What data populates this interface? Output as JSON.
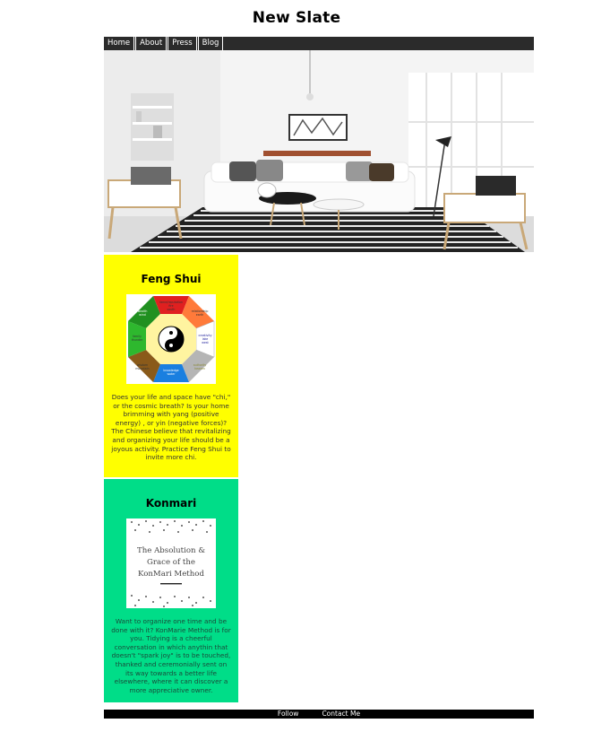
{
  "site": {
    "title": "New Slate"
  },
  "nav": {
    "items": [
      "Home",
      "About",
      "Press",
      "Blog"
    ]
  },
  "colors": {
    "nav_bg": "#2b2b2b",
    "feng_shui_bg": "#ffff00",
    "konmari_bg": "#00dd88",
    "footer_bg": "#000000",
    "accent_red": "#cc2a2a"
  },
  "feng_shui": {
    "title": "Feng Shui",
    "description": "Does your life and space have \"chi,\" or the cosmic breath? Is your home brimming with yang (positive energy) , or yin (negative forces)? The Chinese believe that revitalizing and organizing your life should be a joyous activity. Practice Feng Shui to invite more chi.",
    "bagua": {
      "top": "fame/reputation fire south",
      "top_right": "relationship earth southwest",
      "right": "creativity lake west",
      "bottom_right": "authority heaven northwest",
      "bottom": "knowledge water north",
      "bottom_left": "wisdom mountain northeast",
      "left": "family thunder east",
      "top_left": "wealth wind southeast"
    }
  },
  "konmari": {
    "title": "Konmari",
    "image_text": [
      "The Absolution &",
      "Grace of the",
      "KonMari Method"
    ],
    "description": "Want to organize one time and be done with it? KonMarie Method is for you. Tidying is a cheerful conversation in which anythin that doesn't \"spark joy\" is to be touched, thanked and ceremonially sent on its way towards a better life elsewhere, where it can discover a more appreciative owner."
  },
  "footer": {
    "links": [
      "Follow",
      "Contact Me"
    ]
  }
}
